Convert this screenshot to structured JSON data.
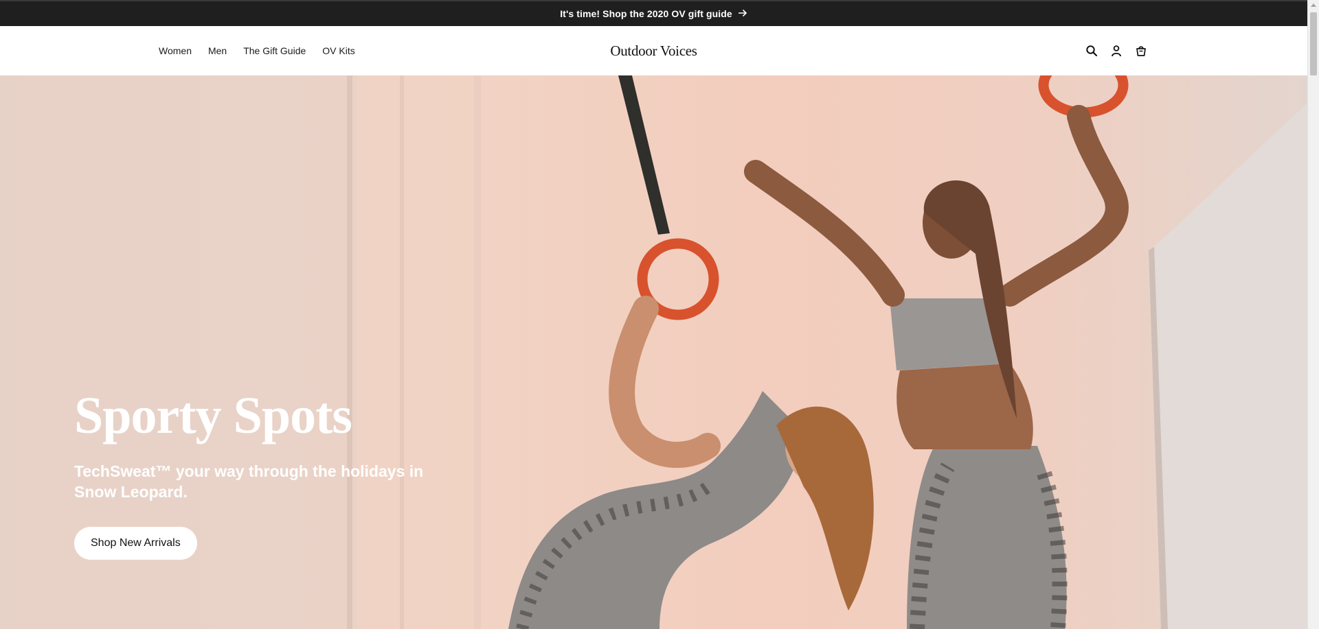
{
  "announcement": {
    "text": "It's time! Shop the 2020 OV gift guide",
    "icon": "arrow-right-icon"
  },
  "nav": {
    "items": [
      {
        "label": "Women"
      },
      {
        "label": "Men"
      },
      {
        "label": "The Gift Guide"
      },
      {
        "label": "OV Kits"
      }
    ]
  },
  "brand": {
    "name": "Outdoor Voices"
  },
  "header_icons": [
    "search-icon",
    "account-icon",
    "cart-icon"
  ],
  "hero": {
    "title": "Sporty Spots",
    "subtitle": "TechSweat™ your way through the holidays in Snow Leopard.",
    "button_label": "Shop New Arrivals"
  },
  "colors": {
    "announcement_bg": "#1f1f1f",
    "accent_orange": "#d8522e",
    "text_dark": "#111111"
  }
}
